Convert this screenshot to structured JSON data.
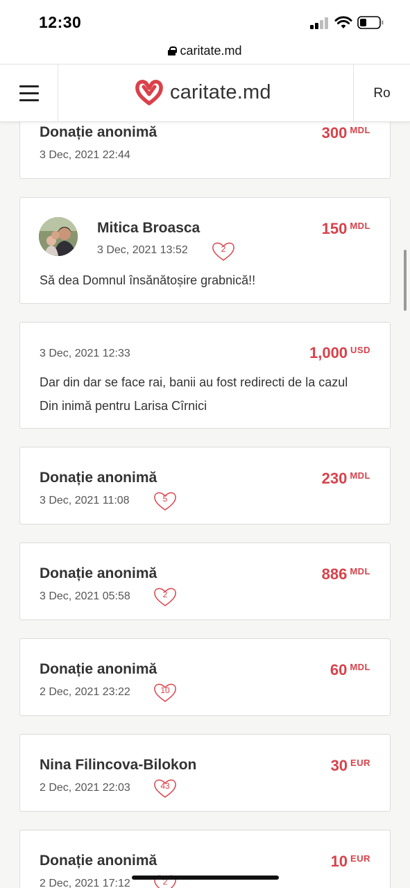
{
  "status": {
    "time": "12:30"
  },
  "browser": {
    "url": "caritate.md"
  },
  "header": {
    "logo_text": "caritate.md",
    "language": "Ro"
  },
  "brand_color": "#d9414a",
  "donations": [
    {
      "name": "Donație anonimă",
      "date": "3 Dec, 2021 22:44",
      "amount": "300",
      "currency": "MDL",
      "likes": null,
      "message": null
    },
    {
      "name": "Mitica Broasca",
      "date": "3 Dec, 2021 13:52",
      "amount": "150",
      "currency": "MDL",
      "likes": "2",
      "message": "Să dea Domnul însănătoșire grabnică!!",
      "avatar": "user-photo"
    },
    {
      "name": null,
      "date": "3 Dec, 2021 12:33",
      "amount": "1,000",
      "currency": "USD",
      "likes": null,
      "message": "Dar din dar se face rai, banii au fost redirecti de la cazul Din inimă pentru Larisa Cîrnici"
    },
    {
      "name": "Donație anonimă",
      "date": "3 Dec, 2021 11:08",
      "amount": "230",
      "currency": "MDL",
      "likes": "5",
      "message": null
    },
    {
      "name": "Donație anonimă",
      "date": "3 Dec, 2021 05:58",
      "amount": "886",
      "currency": "MDL",
      "likes": "2",
      "message": null
    },
    {
      "name": "Donație anonimă",
      "date": "2 Dec, 2021 23:22",
      "amount": "60",
      "currency": "MDL",
      "likes": "10",
      "message": null
    },
    {
      "name": "Nina Filincova-Bilokon",
      "date": "2 Dec, 2021 22:03",
      "amount": "30",
      "currency": "EUR",
      "likes": "43",
      "message": null
    },
    {
      "name": "Donație anonimă",
      "date": "2 Dec, 2021 17:12",
      "amount": "10",
      "currency": "EUR",
      "likes": "2",
      "message": null
    }
  ]
}
